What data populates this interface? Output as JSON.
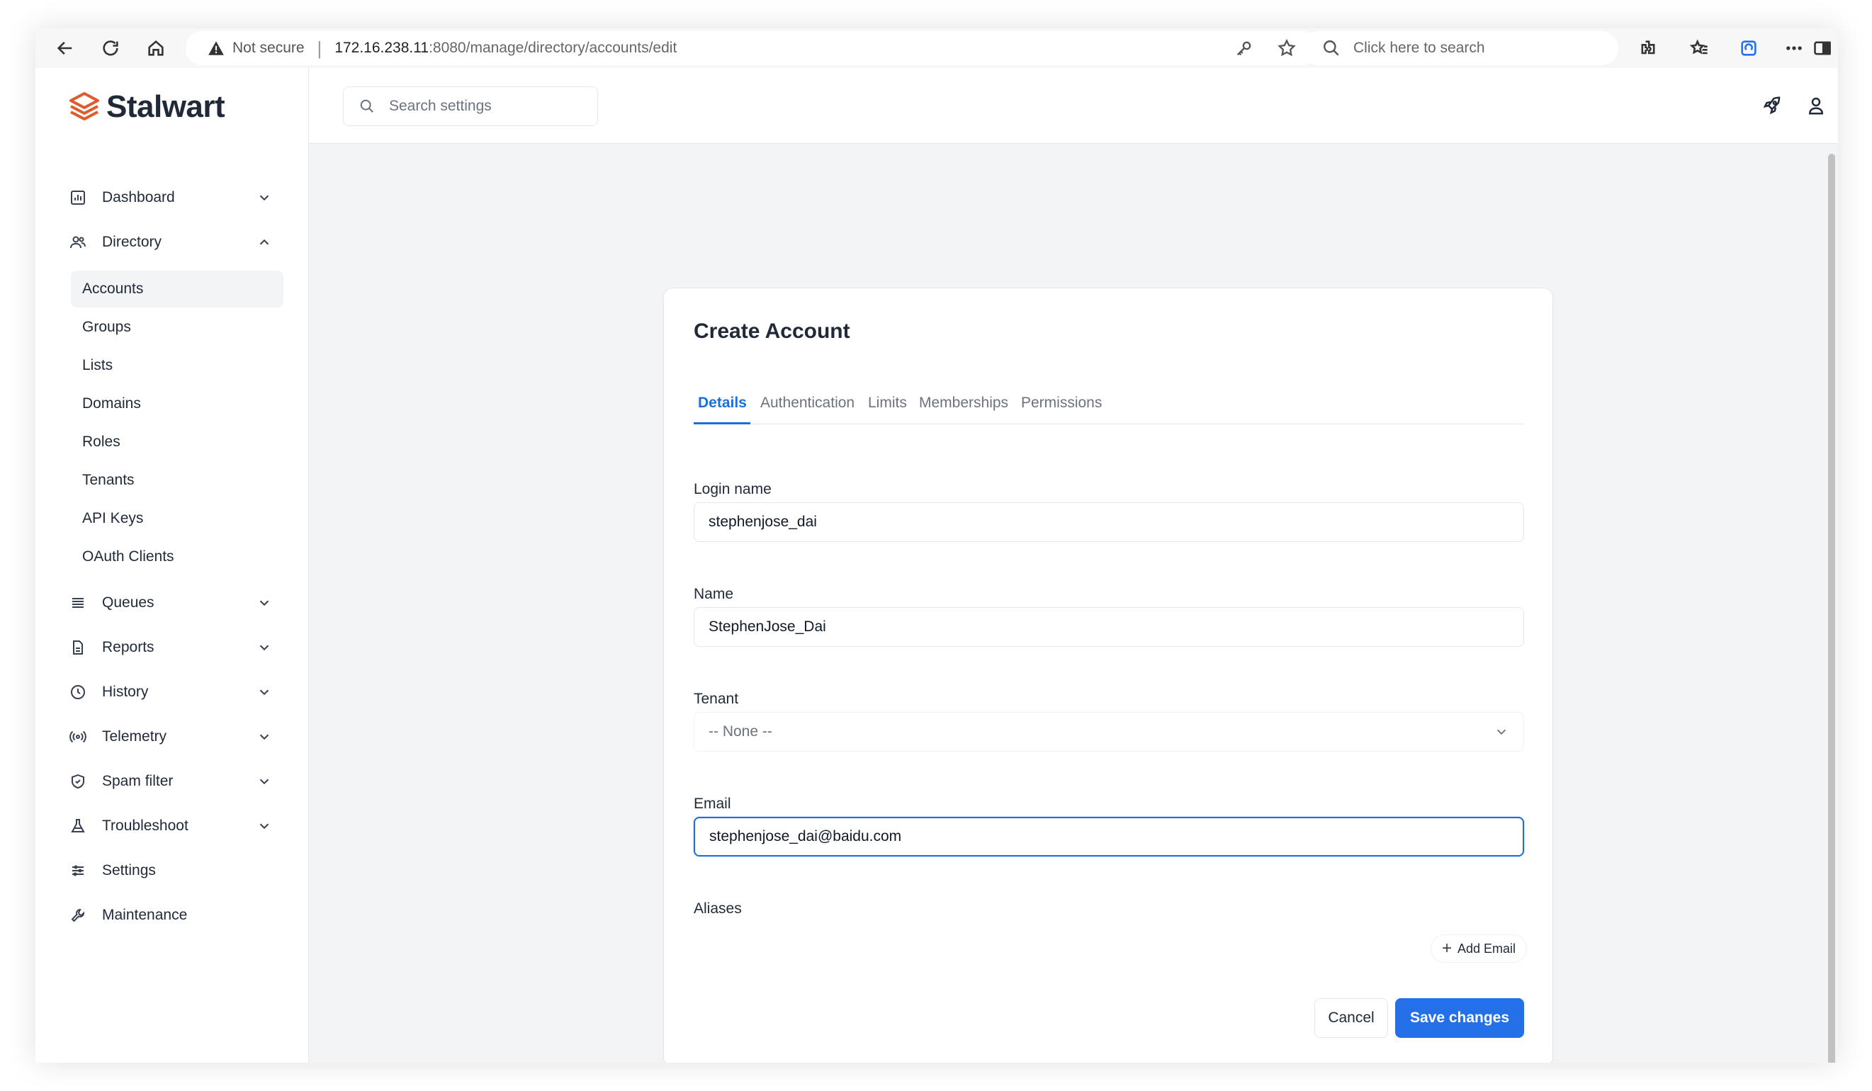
{
  "browser": {
    "security_label": "Not secure",
    "url_host": "172.16.238.11",
    "url_path": ":8080/manage/directory/accounts/edit",
    "search_placeholder": "Click here to search"
  },
  "app": {
    "brand": "Stalwart",
    "brand_color": "#e05a2b",
    "accent_color": "#2370e8"
  },
  "sidebar": {
    "items": [
      {
        "label": "Dashboard",
        "icon": "chart-icon",
        "expandable": true,
        "expanded": false
      },
      {
        "label": "Directory",
        "icon": "users-icon",
        "expandable": true,
        "expanded": true
      },
      {
        "label": "Queues",
        "icon": "list-icon",
        "expandable": true,
        "expanded": false
      },
      {
        "label": "Reports",
        "icon": "document-icon",
        "expandable": true,
        "expanded": false
      },
      {
        "label": "History",
        "icon": "clock-icon",
        "expandable": true,
        "expanded": false
      },
      {
        "label": "Telemetry",
        "icon": "broadcast-icon",
        "expandable": true,
        "expanded": false
      },
      {
        "label": "Spam filter",
        "icon": "shield-icon",
        "expandable": true,
        "expanded": false
      },
      {
        "label": "Troubleshoot",
        "icon": "flask-icon",
        "expandable": true,
        "expanded": false
      },
      {
        "label": "Settings",
        "icon": "sliders-icon",
        "expandable": false
      },
      {
        "label": "Maintenance",
        "icon": "wrench-icon",
        "expandable": false
      }
    ],
    "directory_sub": [
      "Accounts",
      "Groups",
      "Lists",
      "Domains",
      "Roles",
      "Tenants",
      "API Keys",
      "OAuth Clients"
    ],
    "active_sub": "Accounts"
  },
  "topbar": {
    "search_placeholder": "Search settings"
  },
  "form": {
    "title": "Create Account",
    "tabs": [
      "Details",
      "Authentication",
      "Limits",
      "Memberships",
      "Permissions"
    ],
    "active_tab": "Details",
    "login_name": {
      "label": "Login name",
      "value": "stephenjose_dai"
    },
    "name": {
      "label": "Name",
      "value": "StephenJose_Dai"
    },
    "tenant": {
      "label": "Tenant",
      "value": "-- None --"
    },
    "email": {
      "label": "Email",
      "value": "stephenjose_dai@baidu.com"
    },
    "aliases": {
      "label": "Aliases",
      "add_label": "Add Email"
    },
    "cancel_label": "Cancel",
    "save_label": "Save changes"
  }
}
